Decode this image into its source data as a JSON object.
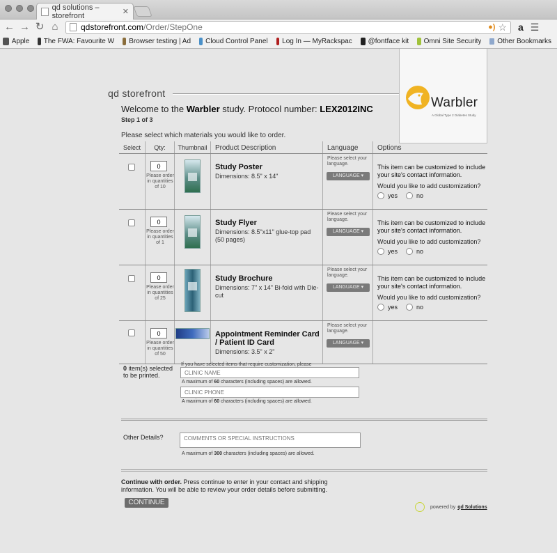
{
  "browser": {
    "tab_title": "qd solutions – storefront",
    "url_host": "qdstorefront.com",
    "url_path": "/Order/StepOne",
    "bookmarks": [
      {
        "label": "Apple",
        "color": "#555555"
      },
      {
        "label": "The FWA: Favourite W",
        "color": "#333333"
      },
      {
        "label": "Browser testing | Ad",
        "color": "#8a6d3b"
      },
      {
        "label": "Cloud Control Panel",
        "color": "#4a90c8"
      },
      {
        "label": "Log In — MyRackspac",
        "color": "#b01e1e"
      },
      {
        "label": "@fontface kit",
        "color": "#222222"
      },
      {
        "label": "Omni Site Security",
        "color": "#a0c23a"
      }
    ],
    "other_bookmarks": "Other Bookmarks",
    "rss_label": "●)",
    "amazon_label": "a"
  },
  "brand": {
    "name": "qd storefront",
    "logo_word": "Warbler",
    "logo_tagline": "A Global Type 2 Diabetes Study",
    "accent": "#f0b323"
  },
  "header": {
    "welcome_pre": "Welcome to the",
    "study_name": "Warbler",
    "welcome_mid": "study. Protocol number:",
    "protocol": "LEX2012INC",
    "step": "Step 1 of 3",
    "instruction": "Please select which materials you would like to order."
  },
  "table": {
    "columns": [
      "Select",
      "Qty:",
      "Thumbnail",
      "Product Description",
      "Language",
      "Options"
    ],
    "lang_note": "Please select your language.",
    "lang_button": "LANGUAGE ▾",
    "opt_text": "This item can be customized to include your site's contact information.",
    "opt_question": "Would you like to add customization?",
    "opt_yes": "yes",
    "opt_no": "no",
    "rows": [
      {
        "name": "Study Poster",
        "dims": "Dimensions: 8.5\" x 14\"",
        "qty": "0",
        "qty_note": "Please order in quantities of 10"
      },
      {
        "name": "Study Flyer",
        "dims": "Dimensions: 8.5\"x11\" glue-top pad (50 pages)",
        "qty": "0",
        "qty_note": "Please order in quantities of 1"
      },
      {
        "name": "Study Brochure",
        "dims": "Dimensions: 7\" x 14\" Bi-fold with Die-cut",
        "qty": "0",
        "qty_note": "Please order in quantities of 25"
      },
      {
        "name": "Appointment Reminder Card / Patient ID Card",
        "dims": "Dimensions: 3.5\" x 2\"",
        "qty": "0",
        "qty_note": "Please order in quantities of 50"
      }
    ]
  },
  "customization": {
    "count": "0",
    "count_text": "item(s) selected to be printed.",
    "note": "If you have selected items that require customization, please enter the site-specific contact info you would like to have printed on these materials.",
    "clinic_name_placeholder": "CLINIC NAME",
    "clinic_phone_placeholder": "CLINIC PHONE",
    "limit_pre": "A maximum of",
    "limit_60": "60",
    "limit_post": "characters (including spaces) are allowed."
  },
  "other": {
    "label": "Other Details?",
    "placeholder": "COMMENTS OR SPECIAL INSTRUCTIONS",
    "limit_300": "300"
  },
  "footer": {
    "continue_bold": "Continue with order.",
    "continue_text": "Press continue to enter in your contact and shipping information. You will be able to review your order details before submitting.",
    "continue_button": "CONTINUE",
    "powered_pre": "powered by",
    "powered_brand": "qd Solutions"
  }
}
